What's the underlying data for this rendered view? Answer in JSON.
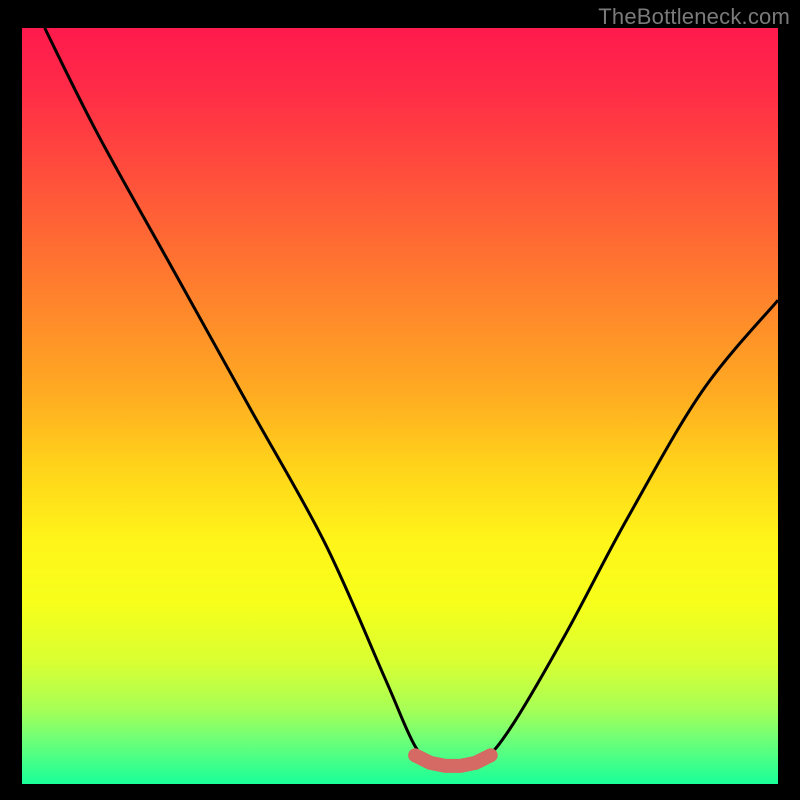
{
  "attribution": "TheBottleneck.com",
  "colors": {
    "page_bg": "#000000",
    "curve": "#000000",
    "marker": "#d46a63",
    "attribution_text": "#7a7a7a"
  },
  "chart_data": {
    "type": "line",
    "title": "",
    "xlabel": "",
    "ylabel": "",
    "xlim": [
      0,
      100
    ],
    "ylim": [
      0,
      100
    ],
    "grid": false,
    "series": [
      {
        "name": "bottleneck-curve",
        "x": [
          3,
          10,
          20,
          30,
          40,
          48,
          52,
          55,
          58,
          61,
          65,
          72,
          80,
          90,
          100
        ],
        "values": [
          100,
          86,
          68,
          50,
          32,
          14,
          5,
          2,
          2,
          3,
          8,
          20,
          35,
          52,
          64
        ]
      }
    ],
    "markers": {
      "name": "optimal-range",
      "x": [
        52,
        54,
        56,
        58,
        60,
        62
      ],
      "values": [
        3.8,
        2.8,
        2.4,
        2.4,
        2.8,
        3.8
      ]
    }
  }
}
